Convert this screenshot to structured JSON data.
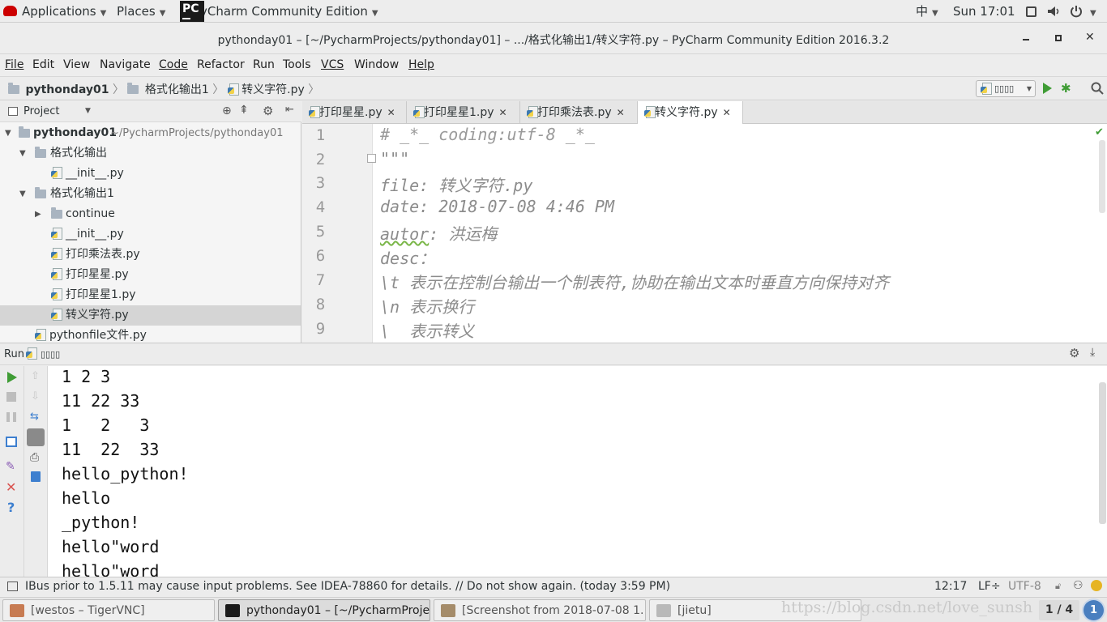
{
  "topbar": {
    "applications": "Applications",
    "places": "Places",
    "app_name": "PyCharm Community Edition",
    "app_icon_letters": "PC",
    "input_method": "中",
    "clock": "Sun 17:01"
  },
  "window": {
    "title": "pythonday01 – [~/PycharmProjects/pythonday01] – .../格式化输出1/转义字符.py – PyCharm Community Edition 2016.3.2"
  },
  "menubar": {
    "file": "File",
    "edit": "Edit",
    "view": "View",
    "navigate": "Navigate",
    "code": "Code",
    "refactor": "Refactor",
    "run": "Run",
    "tools": "Tools",
    "vcs": "VCS",
    "window": "Window",
    "help": "Help"
  },
  "navbar": {
    "crumbs": [
      "pythonday01",
      "格式化输出1",
      "转义字符.py"
    ],
    "run_config": "▯▯▯▯"
  },
  "project": {
    "panel_title": "Project",
    "tree": [
      {
        "label": "pythonday01",
        "hint": "~/PycharmProjects/pythonday01"
      },
      {
        "label": "格式化输出"
      },
      {
        "label": "__init__.py"
      },
      {
        "label": "格式化输出1"
      },
      {
        "label": "continue"
      },
      {
        "label": "__init__.py"
      },
      {
        "label": "打印乘法表.py"
      },
      {
        "label": "打印星星.py"
      },
      {
        "label": "打印星星1.py"
      },
      {
        "label": "转义字符.py"
      },
      {
        "label": "pythonfile文件.py"
      }
    ]
  },
  "tabs": [
    "打印星星.py",
    "打印星星1.py",
    "打印乘法表.py",
    "转义字符.py"
  ],
  "editor": {
    "line_numbers": [
      "1",
      "2",
      "3",
      "4",
      "5",
      "6",
      "7",
      "8",
      "9"
    ],
    "lines": [
      "# _*_ coding:utf-8 _*_",
      "\"\"\"",
      "file: 转义字符.py",
      "date: 2018-07-08 4:46 PM",
      "autor",
      ": 洪运梅",
      "desc：",
      "\\t 表示在控制台输出一个制表符,协助在输出文本时垂直方向保持对齐",
      "\\n 表示换行",
      "\\  表示转义"
    ]
  },
  "run": {
    "label": "Run",
    "config": "▯▯▯▯",
    "output": [
      "1 2 3",
      "11 22 33",
      "1\t2\t3",
      "11\t22\t33",
      "hello_python!",
      "hello",
      "_python!",
      "hello\"word",
      "hello\"word"
    ]
  },
  "status": {
    "message": "IBus prior to 1.5.11 may cause input problems. See IDEA-78860 for details. // Do not show again. (today 3:59 PM)",
    "position": "12:17",
    "line_sep": "LF÷",
    "encoding": "UTF-8"
  },
  "taskbar": {
    "items": [
      "[westos – TigerVNC]",
      "pythonday01 – [~/PycharmProjec...",
      "[Screenshot from 2018-07-08 1...",
      "[jietu]"
    ],
    "watermark": "https://blog.csdn.net/love_sunsh",
    "workspace": "1 / 4",
    "badge": "1"
  },
  "colors": {
    "run_green": "#3f9c35",
    "debug_green": "#3f9c35",
    "stop_red": "#d9534f",
    "help_blue": "#3d7fcf"
  }
}
